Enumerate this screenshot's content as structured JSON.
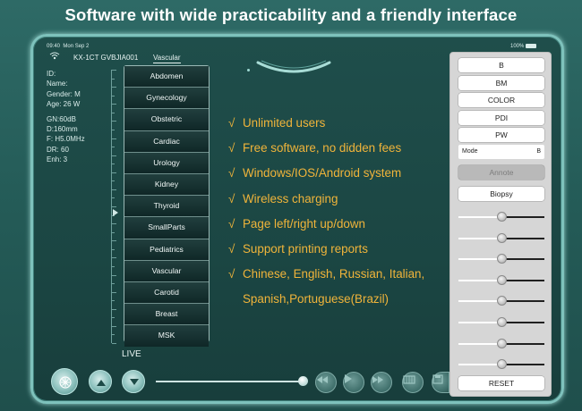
{
  "banner": {
    "title": "Software with wide practicability and a friendly interface"
  },
  "status": {
    "time": "09:40",
    "date": "Mon Sep 2",
    "battery": "100%",
    "device_id": "KX-1CT GVBJIA001",
    "exam_tab": "Vascular"
  },
  "patient": {
    "id": "ID:",
    "name": "Name:",
    "gender": "Gender: M",
    "age": "Age: 26 W",
    "gain": "GN:60dB",
    "depth": "D:160mm",
    "freq": "F: H5.0MHz",
    "dr": "DR: 60",
    "enh": "Enh: 3"
  },
  "presets": [
    "Abdomen",
    "Gynecology",
    "Obstetric",
    "Cardiac",
    "Urology",
    "Kidney",
    "Thyroid",
    "SmallParts",
    "Pediatrics",
    "Vascular",
    "Carotid",
    "Breast",
    "MSK"
  ],
  "live_label": "LIVE",
  "features": {
    "check": "√",
    "items": [
      "Unlimited users",
      "Free software, no didden fees",
      "Windows/IOS/Android system",
      "Wireless charging",
      "Page left/right up/down",
      "Support printing reports",
      "Chinese, English, Russian, Italian,"
    ],
    "continuation": "Spanish,Portuguese(Brazil)"
  },
  "panel": {
    "mode_buttons": [
      "B",
      "BM",
      "COLOR",
      "PDI",
      "PW"
    ],
    "mode_label": "Mode",
    "mode_value": "B",
    "annotate": "Annote",
    "biopsy": "Biopsy",
    "reset": "RESET",
    "slider_levels": [
      0.5,
      0.5,
      0.5,
      0.5,
      0.5,
      0.5,
      0.5,
      0.5
    ]
  },
  "colors": {
    "background": "#245b57",
    "feature_text": "#f0b43a",
    "panel_bg": "#d6d6d6",
    "tablet_border": "#7ec2bc"
  },
  "icons": [
    "wifi-icon",
    "freeze-icon",
    "arrow-up-icon",
    "arrow-down-icon",
    "rewind-icon",
    "play-icon",
    "fast-forward-icon",
    "film-icon",
    "save-icon"
  ]
}
